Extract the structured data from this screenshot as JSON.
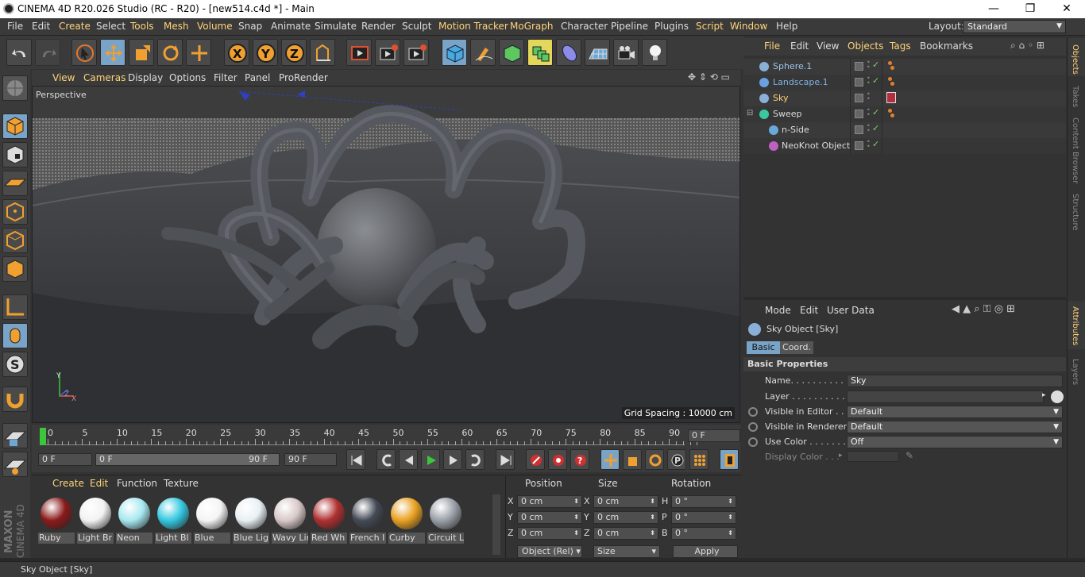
{
  "window": {
    "title": "CINEMA 4D R20.026 Studio (RC - R20) - [new514.c4d *] - Main",
    "minimize": "—",
    "restore": "❐",
    "close": "✕"
  },
  "menubar": {
    "items": [
      "File",
      "Edit",
      "Create",
      "Select",
      "Tools",
      "Mesh",
      "Volume",
      "Snap",
      "Animate",
      "Simulate",
      "Render",
      "Sculpt",
      "Motion Tracker",
      "MoGraph",
      "Character",
      "Pipeline",
      "Plugins",
      "Script",
      "Window",
      "Help"
    ],
    "layout_label": "Layout:",
    "layout_value": "Standard"
  },
  "toolbar": {
    "icons": [
      "undo-icon",
      "redo-icon",
      "live-selection-icon",
      "move-icon",
      "scale-icon",
      "rotate-icon",
      "last-tool-icon",
      "x-axis-icon",
      "y-axis-icon",
      "z-axis-icon",
      "coordinate-system-icon",
      "render-view-icon",
      "render-picture-viewer-icon",
      "edit-render-settings-icon",
      "cube-icon",
      "pen-icon",
      "subdivision-icon",
      "array-icon",
      "deformer-icon",
      "floor-icon",
      "camera-icon",
      "light-icon"
    ],
    "x_label": "X",
    "y_label": "Y",
    "z_label": "Z"
  },
  "viewport": {
    "menu": [
      "View",
      "Cameras",
      "Display",
      "Options",
      "Filter",
      "Panel",
      "ProRender"
    ],
    "label": "Perspective",
    "grid_spacing": "Grid Spacing : 10000 cm",
    "axis": {
      "y": "Y",
      "z": "Z",
      "x": "X"
    }
  },
  "timeline": {
    "ticks": [
      "0",
      "5",
      "10",
      "15",
      "20",
      "25",
      "30",
      "35",
      "40",
      "45",
      "50",
      "55",
      "60",
      "65",
      "70",
      "75",
      "80",
      "85",
      "90"
    ],
    "current": "0 F",
    "start": "0 F",
    "range_start": "0 F",
    "range_end": "90 F",
    "end": "90 F"
  },
  "materials": {
    "menu": [
      "Create",
      "Edit",
      "Function",
      "Texture"
    ],
    "items": [
      {
        "label": "Ruby",
        "color": "#8a1a1a"
      },
      {
        "label": "Light Br",
        "color": "#f2f2f2"
      },
      {
        "label": "Neon",
        "color": "#a6e8f0"
      },
      {
        "label": "Light Bl",
        "color": "#34c8e0"
      },
      {
        "label": "Blue",
        "color": "#f4f4f4"
      },
      {
        "label": "Blue Lig",
        "color": "#e8f0f4"
      },
      {
        "label": "Wavy Lir",
        "color": "#d8c8c8"
      },
      {
        "label": "Red Wh",
        "color": "#b03030"
      },
      {
        "label": "French I",
        "color": "#444a55"
      },
      {
        "label": "Curby",
        "color": "#e8a020"
      },
      {
        "label": "Circuit L",
        "color": "#9aa0a8"
      }
    ]
  },
  "coords": {
    "headers": [
      "Position",
      "Size",
      "Rotation"
    ],
    "rows": [
      {
        "a": "X",
        "pos": "0 cm",
        "b": "X",
        "size": "0 cm",
        "c": "H",
        "rot": "0 °"
      },
      {
        "a": "Y",
        "pos": "0 cm",
        "b": "Y",
        "size": "0 cm",
        "c": "P",
        "rot": "0 °"
      },
      {
        "a": "Z",
        "pos": "0 cm",
        "b": "Z",
        "size": "0 cm",
        "c": "B",
        "rot": "0 °"
      }
    ],
    "mode": "Object (Rel)",
    "size_mode": "Size",
    "apply": "Apply"
  },
  "objects_panel": {
    "menu": [
      "File",
      "Edit",
      "View",
      "Objects",
      "Tags",
      "Bookmarks"
    ],
    "items": [
      {
        "name": "Sphere.1",
        "indent": 0,
        "color": "#9ec4ea"
      },
      {
        "name": "Landscape.1",
        "indent": 0,
        "color": "#7fb0e0"
      },
      {
        "name": "Sky",
        "indent": 0,
        "color": "#ffd37a"
      },
      {
        "name": "Sweep",
        "indent": 0,
        "color": "#ddd"
      },
      {
        "name": "n-Side",
        "indent": 1,
        "color": "#ddd"
      },
      {
        "name": "NeoKnot Object",
        "indent": 1,
        "color": "#ddd"
      }
    ]
  },
  "attributes": {
    "menu": [
      "Mode",
      "Edit",
      "User Data"
    ],
    "object_title": "Sky Object [Sky]",
    "tabs": [
      "Basic",
      "Coord."
    ],
    "section": "Basic Properties",
    "name_label": "Name. . . . . . . . . . . . .",
    "name_value": "Sky",
    "layer_label": "Layer . . . . . . . . . . . .",
    "visible_editor_label": "Visible in Editor . . .",
    "visible_editor_value": "Default",
    "visible_renderer_label": "Visible in Renderer",
    "visible_renderer_value": "Default",
    "use_color_label": "Use Color . . . . . . . .",
    "use_color_value": "Off",
    "display_color_label": "Display Color . . ."
  },
  "side_tabs": [
    "Objects",
    "Takes",
    "Content Browser",
    "Structure"
  ],
  "side_tabs2": [
    "Attributes",
    "Layers"
  ],
  "status": "Sky Object [Sky]",
  "brand": {
    "maxon": "MAXON",
    "product": "CINEMA 4D"
  }
}
